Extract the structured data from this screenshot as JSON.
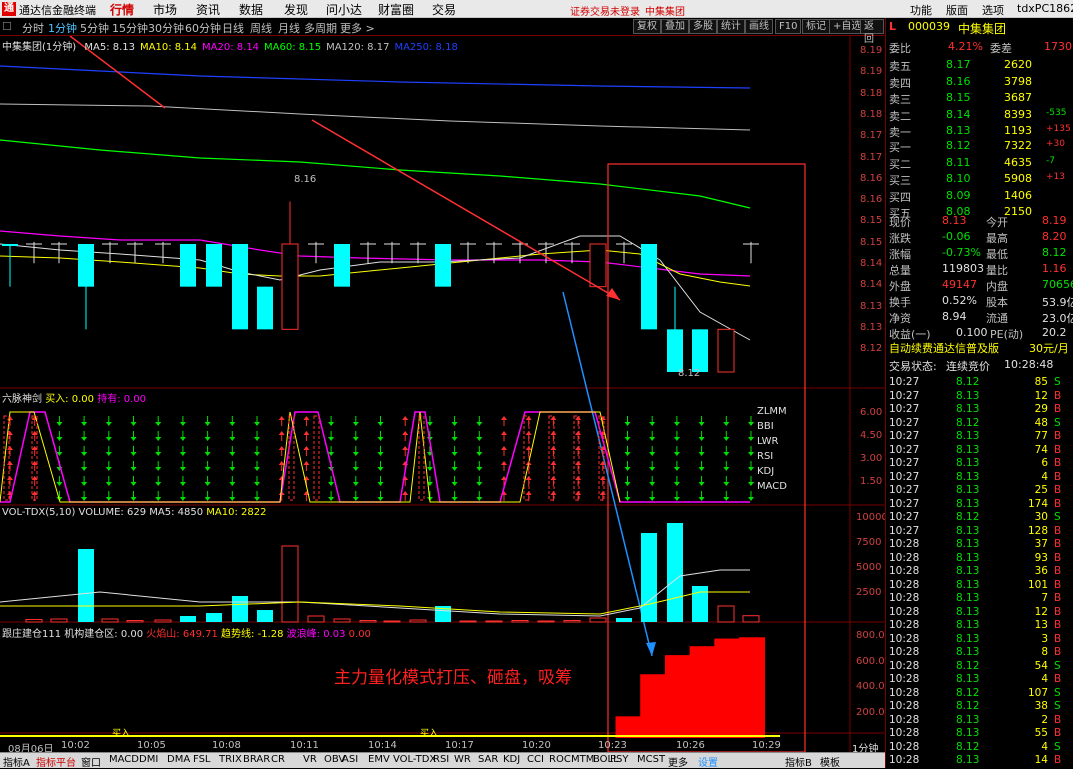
{
  "app": {
    "name": "通达信金融终端",
    "logo": "通",
    "tabs": [
      "行情",
      "市场",
      "资讯",
      "数据",
      "发现",
      "问小达",
      "财富圈",
      "交易"
    ],
    "active_tab": "行情",
    "warning": "证券交易未登录",
    "warn_stock": "中集集团",
    "right_menu": [
      "功能",
      "版面",
      "选项"
    ],
    "user": "tdxPC18621"
  },
  "toolbar": {
    "periods": [
      "分时",
      "1分钟",
      "5分钟",
      "15分钟",
      "30分钟",
      "60分钟",
      "日线",
      "周线",
      "月线",
      "多周期",
      "更多 >"
    ],
    "selected": "1分钟",
    "right_buttons": [
      "复权",
      "叠加",
      "多股",
      "统计",
      "画线",
      "F10",
      "标记",
      "+自选",
      "返回"
    ]
  },
  "main_chart": {
    "title": "中集集团(1分钟)",
    "ma": [
      {
        "label": "MA5: 8.13",
        "color": "#e0e0e0"
      },
      {
        "label": "MA10: 8.14",
        "color": "#ffff00"
      },
      {
        "label": "MA20: 8.14",
        "color": "#ff00ff"
      },
      {
        "label": "MA60: 8.15",
        "color": "#00ff00"
      },
      {
        "label": "MA120: 8.17",
        "color": "#c0c0c0"
      },
      {
        "label": "MA250: 8.18",
        "color": "#2040ff"
      }
    ],
    "high_label": "8.16",
    "low_label": "8.12",
    "y_ticks": [
      "8.19",
      "8.19",
      "8.18",
      "8.18",
      "8.17",
      "8.17",
      "8.16",
      "8.16",
      "8.15",
      "8.15",
      "8.14",
      "8.14",
      "8.13",
      "8.13",
      "8.12"
    ]
  },
  "six_panel": {
    "title": "六脉神剑",
    "buy": "买入: 0.00",
    "hold": "持有: 0.00",
    "labels": [
      "ZLMM",
      "BBI",
      "LWR",
      "RSI",
      "KDJ",
      "MACD"
    ],
    "y_ticks": [
      "6.00",
      "4.50",
      "3.00",
      "1.50"
    ]
  },
  "vol_panel": {
    "title": "VOL-TDX(5,10)",
    "volume": "VOLUME: 629",
    "ma5": "MA5: 4850",
    "ma10": "MA10: 2822",
    "y_ticks": [
      "10000",
      "7500",
      "5000",
      "2500"
    ]
  },
  "inst_panel": {
    "title": "跟庄建仓111",
    "inst": "机构建仓区: 0.00",
    "fire": "火焰山: 649.71",
    "trend": "趋势线: -1.28",
    "wave": "波浪峰: 0.03",
    "zero": "0.00",
    "annotation": "主力量化模式打压、砸盘，吸筹",
    "buy_label": "买入",
    "y_ticks": [
      "800.0",
      "600.0",
      "400.0",
      "200.0"
    ],
    "chart_data": {
      "type": "bar",
      "values": [
        0,
        0,
        0,
        0,
        0,
        0,
        0,
        0,
        0,
        0,
        0,
        0,
        0,
        0,
        0,
        0,
        0,
        0,
        0,
        0,
        0,
        0,
        0,
        0,
        0,
        170,
        500,
        650,
        720,
        780,
        790
      ]
    }
  },
  "time_axis": {
    "labels": [
      "08月06日",
      "10:02",
      "10:05",
      "10:08",
      "10:11",
      "10:14",
      "10:17",
      "10:20",
      "10:23",
      "10:26",
      "10:29"
    ],
    "period": "1分钟"
  },
  "bottom": {
    "tabs": [
      "指标A",
      "指标平台",
      "窗口",
      "MACD",
      "DMI",
      "DMA",
      "FSL",
      "TRIX",
      "BRAR",
      "CR",
      "VR",
      "OBV",
      "ASI",
      "EMV",
      "VOL-TDX",
      "RSI",
      "WR",
      "SAR",
      "KDJ",
      "CCI",
      "ROC",
      "MTM",
      "BOLL",
      "PSY",
      "MCST",
      "更多",
      "设置",
      "指标B",
      "模板"
    ]
  },
  "quote": {
    "flag": "L",
    "code": "000039",
    "name": "中集集团",
    "weibi_label": "委比",
    "weibi": "4.21%",
    "weicha_label": "委差",
    "weicha": "1730",
    "sells": [
      {
        "l": "卖五",
        "p": "8.17",
        "v": "2620",
        "d": ""
      },
      {
        "l": "卖四",
        "p": "8.16",
        "v": "3798",
        "d": ""
      },
      {
        "l": "卖三",
        "p": "8.15",
        "v": "3687",
        "d": ""
      },
      {
        "l": "卖二",
        "p": "8.14",
        "v": "8393",
        "d": "-535"
      },
      {
        "l": "卖一",
        "p": "8.13",
        "v": "1193",
        "d": "+135"
      }
    ],
    "buys": [
      {
        "l": "买一",
        "p": "8.12",
        "v": "7322",
        "d": "+30"
      },
      {
        "l": "买二",
        "p": "8.11",
        "v": "4635",
        "d": "-7"
      },
      {
        "l": "买三",
        "p": "8.10",
        "v": "5908",
        "d": "+13"
      },
      {
        "l": "买四",
        "p": "8.09",
        "v": "1406",
        "d": ""
      },
      {
        "l": "买五",
        "p": "8.08",
        "v": "2150",
        "d": ""
      }
    ],
    "stats": [
      [
        "现价",
        "8.13",
        "今开",
        "8.19"
      ],
      [
        "涨跌",
        "-0.06",
        "最高",
        "8.20"
      ],
      [
        "涨幅",
        "-0.73%",
        "最低",
        "8.12"
      ],
      [
        "总量",
        "119803",
        "量比",
        "1.16"
      ],
      [
        "外盘",
        "49147",
        "内盘",
        "70656"
      ],
      [
        "换手",
        "0.52%",
        "股本",
        "53.9亿"
      ],
      [
        "净资",
        "8.94",
        "流通",
        "23.0亿"
      ],
      [
        "收益(一)",
        "0.100",
        "PE(动)",
        "20.2"
      ]
    ],
    "ad": "自动续费通达信普及版",
    "ad_price": "30元/月",
    "status_label": "交易状态:",
    "status": "连续竞价",
    "status_time": "10:28:48",
    "ticks": [
      [
        "10:27",
        "8.12",
        "85",
        "S"
      ],
      [
        "10:27",
        "8.13",
        "12",
        "B"
      ],
      [
        "10:27",
        "8.13",
        "29",
        "B"
      ],
      [
        "10:27",
        "8.12",
        "48",
        "S"
      ],
      [
        "10:27",
        "8.13",
        "77",
        "B"
      ],
      [
        "10:27",
        "8.13",
        "74",
        "B"
      ],
      [
        "10:27",
        "8.13",
        "6",
        "B"
      ],
      [
        "10:27",
        "8.13",
        "4",
        "B"
      ],
      [
        "10:27",
        "8.13",
        "25",
        "B"
      ],
      [
        "10:27",
        "8.13",
        "174",
        "B"
      ],
      [
        "10:27",
        "8.12",
        "30",
        "S"
      ],
      [
        "10:27",
        "8.13",
        "128",
        "B"
      ],
      [
        "10:28",
        "8.13",
        "37",
        "B"
      ],
      [
        "10:28",
        "8.13",
        "93",
        "B"
      ],
      [
        "10:28",
        "8.13",
        "36",
        "B"
      ],
      [
        "10:28",
        "8.13",
        "101",
        "B"
      ],
      [
        "10:28",
        "8.13",
        "7",
        "B"
      ],
      [
        "10:28",
        "8.13",
        "12",
        "B"
      ],
      [
        "10:28",
        "8.13",
        "13",
        "B"
      ],
      [
        "10:28",
        "8.13",
        "3",
        "B"
      ],
      [
        "10:28",
        "8.13",
        "8",
        "B"
      ],
      [
        "10:28",
        "8.12",
        "54",
        "S"
      ],
      [
        "10:28",
        "8.13",
        "4",
        "B"
      ],
      [
        "10:28",
        "8.12",
        "107",
        "S"
      ],
      [
        "10:28",
        "8.12",
        "38",
        "S"
      ],
      [
        "10:28",
        "8.13",
        "2",
        "B"
      ],
      [
        "10:28",
        "8.13",
        "55",
        "B"
      ],
      [
        "10:28",
        "8.12",
        "4",
        "S"
      ],
      [
        "10:28",
        "8.13",
        "14",
        "B"
      ]
    ]
  }
}
